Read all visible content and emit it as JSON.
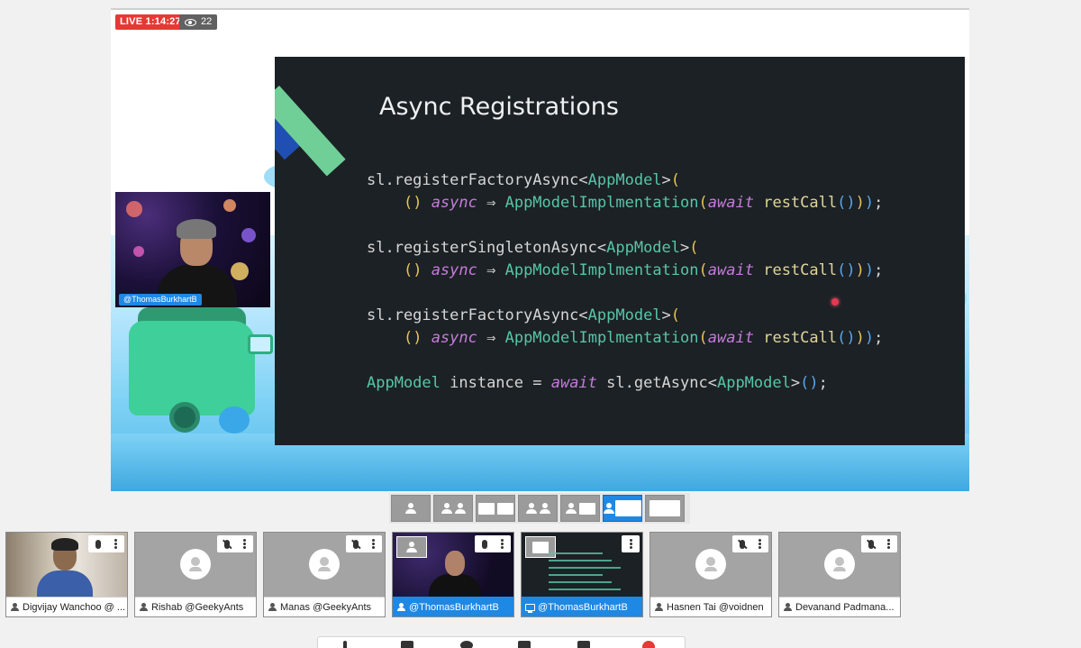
{
  "live": {
    "label": "LIVE 1:14:27",
    "viewers": "22"
  },
  "cam": {
    "label": "@ThomasBurkhartB"
  },
  "slide": {
    "title": "Async Registrations",
    "code": [
      [
        [
          "c-plain",
          "sl.registerFactoryAsync"
        ],
        [
          "c-plain",
          "<"
        ],
        [
          "c-type",
          "AppModel"
        ],
        [
          "c-plain",
          ">"
        ],
        [
          "c-paren",
          "("
        ]
      ],
      [
        [
          "c-plain",
          "    "
        ],
        [
          "c-paren",
          "()"
        ],
        [
          "c-plain",
          " "
        ],
        [
          "c-kw",
          "async"
        ],
        [
          "c-plain",
          " ⇒ "
        ],
        [
          "c-type",
          "AppModelImplmentation"
        ],
        [
          "c-paren",
          "("
        ],
        [
          "c-kw",
          "await"
        ],
        [
          "c-plain",
          " "
        ],
        [
          "c-fn",
          "restCall"
        ],
        [
          "c-blue",
          "()"
        ],
        [
          "c-paren",
          ")"
        ],
        [
          "c-blue",
          ")"
        ],
        [
          "c-plain",
          ";"
        ]
      ],
      [
        [
          "c-plain",
          ""
        ]
      ],
      [
        [
          "c-plain",
          "sl.registerSingletonAsync"
        ],
        [
          "c-plain",
          "<"
        ],
        [
          "c-type",
          "AppModel"
        ],
        [
          "c-plain",
          ">"
        ],
        [
          "c-paren",
          "("
        ]
      ],
      [
        [
          "c-plain",
          "    "
        ],
        [
          "c-paren",
          "()"
        ],
        [
          "c-plain",
          " "
        ],
        [
          "c-kw",
          "async"
        ],
        [
          "c-plain",
          " ⇒ "
        ],
        [
          "c-type",
          "AppModelImplmentation"
        ],
        [
          "c-paren",
          "("
        ],
        [
          "c-kw",
          "await"
        ],
        [
          "c-plain",
          " "
        ],
        [
          "c-fn",
          "restCall"
        ],
        [
          "c-blue",
          "()"
        ],
        [
          "c-paren",
          ")"
        ],
        [
          "c-blue",
          ")"
        ],
        [
          "c-plain",
          ";"
        ]
      ],
      [
        [
          "c-plain",
          ""
        ]
      ],
      [
        [
          "c-plain",
          "sl.registerFactoryAsync"
        ],
        [
          "c-plain",
          "<"
        ],
        [
          "c-type",
          "AppModel"
        ],
        [
          "c-plain",
          ">"
        ],
        [
          "c-paren",
          "("
        ]
      ],
      [
        [
          "c-plain",
          "    "
        ],
        [
          "c-paren",
          "()"
        ],
        [
          "c-plain",
          " "
        ],
        [
          "c-kw",
          "async"
        ],
        [
          "c-plain",
          " ⇒ "
        ],
        [
          "c-type",
          "AppModelImplmentation"
        ],
        [
          "c-paren",
          "("
        ],
        [
          "c-kw",
          "await"
        ],
        [
          "c-plain",
          " "
        ],
        [
          "c-fn",
          "restCall"
        ],
        [
          "c-blue",
          "()"
        ],
        [
          "c-paren",
          ")"
        ],
        [
          "c-blue",
          ")"
        ],
        [
          "c-plain",
          ";"
        ]
      ],
      [
        [
          "c-plain",
          ""
        ]
      ],
      [
        [
          "c-type",
          "AppModel"
        ],
        [
          "c-plain",
          " instance = "
        ],
        [
          "c-kw",
          "await"
        ],
        [
          "c-plain",
          " sl.getAsync<"
        ],
        [
          "c-type",
          "AppModel"
        ],
        [
          "c-plain",
          ">"
        ],
        [
          "c-blue",
          "()"
        ],
        [
          "c-plain",
          ";"
        ]
      ]
    ]
  },
  "layouts": [
    "single-speaker",
    "two-up",
    "grid-small",
    "speaker-list",
    "speaker-screen",
    "sidebar-screen",
    "screen-only"
  ],
  "active_layout": "sidebar-screen",
  "participants": [
    {
      "name": "Digvijay Wanchoo @ ...",
      "mic": "on",
      "style": "video-digvijay"
    },
    {
      "name": "Rishab @GeekyAnts",
      "mic": "muted",
      "style": "avatar"
    },
    {
      "name": "Manas @GeekyAnts",
      "mic": "muted",
      "style": "avatar"
    },
    {
      "name": "@ThomasBurkhartB",
      "mic": "on",
      "style": "video-thomas"
    },
    {
      "name": "@ThomasBurkhartB",
      "mic": "none",
      "style": "screen"
    },
    {
      "name": "Hasnen Tai @voidnen",
      "mic": "muted",
      "style": "avatar"
    },
    {
      "name": "Devanand Padmana...",
      "mic": "muted",
      "style": "avatar"
    }
  ],
  "colors": {
    "live": "#e53935",
    "accent": "#1e88e5",
    "slide_bg": "#1c2125"
  }
}
